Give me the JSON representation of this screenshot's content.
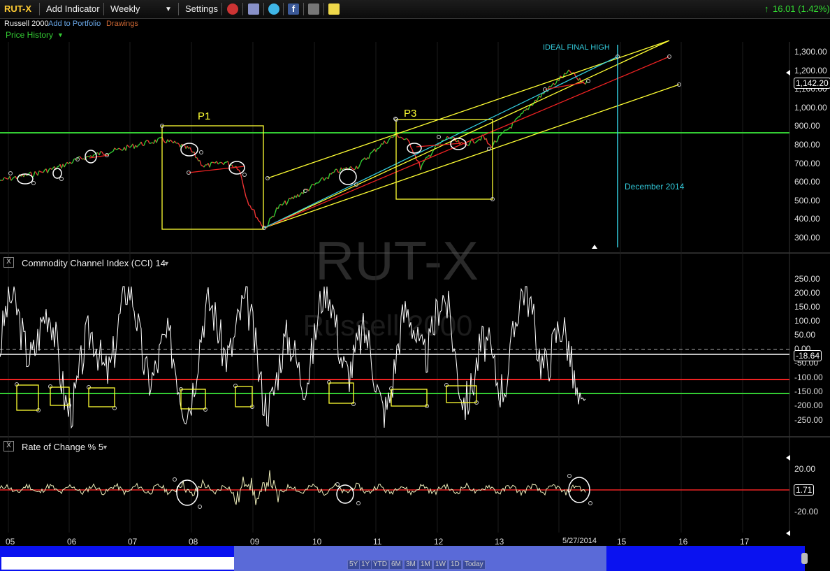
{
  "toolbar": {
    "symbol": "RUT-X",
    "add_indicator": "Add Indicator",
    "interval": "Weekly",
    "settings": "Settings",
    "change": "16.01 (1.42%)"
  },
  "subheader": {
    "name": "Russell 2000",
    "add_portfolio": "Add to Portfolio",
    "drawings": "Drawings",
    "price_history": "Price History"
  },
  "watermark": {
    "symbol": "RUT-X",
    "name": "Russell 2000"
  },
  "price_panel": {
    "y_labels": [
      "1,300.00",
      "1,200.00",
      "1,100.00",
      "1,000.00",
      "900.00",
      "800.00",
      "700.00",
      "600.00",
      "500.00",
      "400.00",
      "300.00"
    ],
    "last_price": "1,142.20",
    "annotations": {
      "p1": "P1",
      "p3": "P3",
      "ideal_high": "IDEAL FINAL HIGH",
      "december": "December 2014"
    }
  },
  "cci_panel": {
    "title": "Commodity Channel Index (CCI) 14",
    "y_labels": [
      "250.00",
      "200.00",
      "150.00",
      "100.00",
      "50.00",
      "0.00",
      "-50.00",
      "-100.00",
      "-150.00",
      "-200.00",
      "-250.00"
    ],
    "last_value": "-18.64"
  },
  "roc_panel": {
    "title": "Rate of Change % 5",
    "y_labels": [
      "20.00",
      "-20.00"
    ],
    "last_value": "1.71"
  },
  "x_axis": [
    "05",
    "06",
    "07",
    "08",
    "09",
    "10",
    "11",
    "12",
    "13",
    "5/27/2014",
    "15",
    "16",
    "17"
  ],
  "range_buttons": [
    "5Y",
    "1Y",
    "YTD",
    "6M",
    "3M",
    "1M",
    "1W",
    "1D",
    "Today"
  ],
  "colors": {
    "up": "#33cc33",
    "down": "#ff3333",
    "channel": "#ffff33",
    "cyan": "#33ccdd",
    "support": "#33cc33",
    "red_line": "#ee2222"
  }
}
